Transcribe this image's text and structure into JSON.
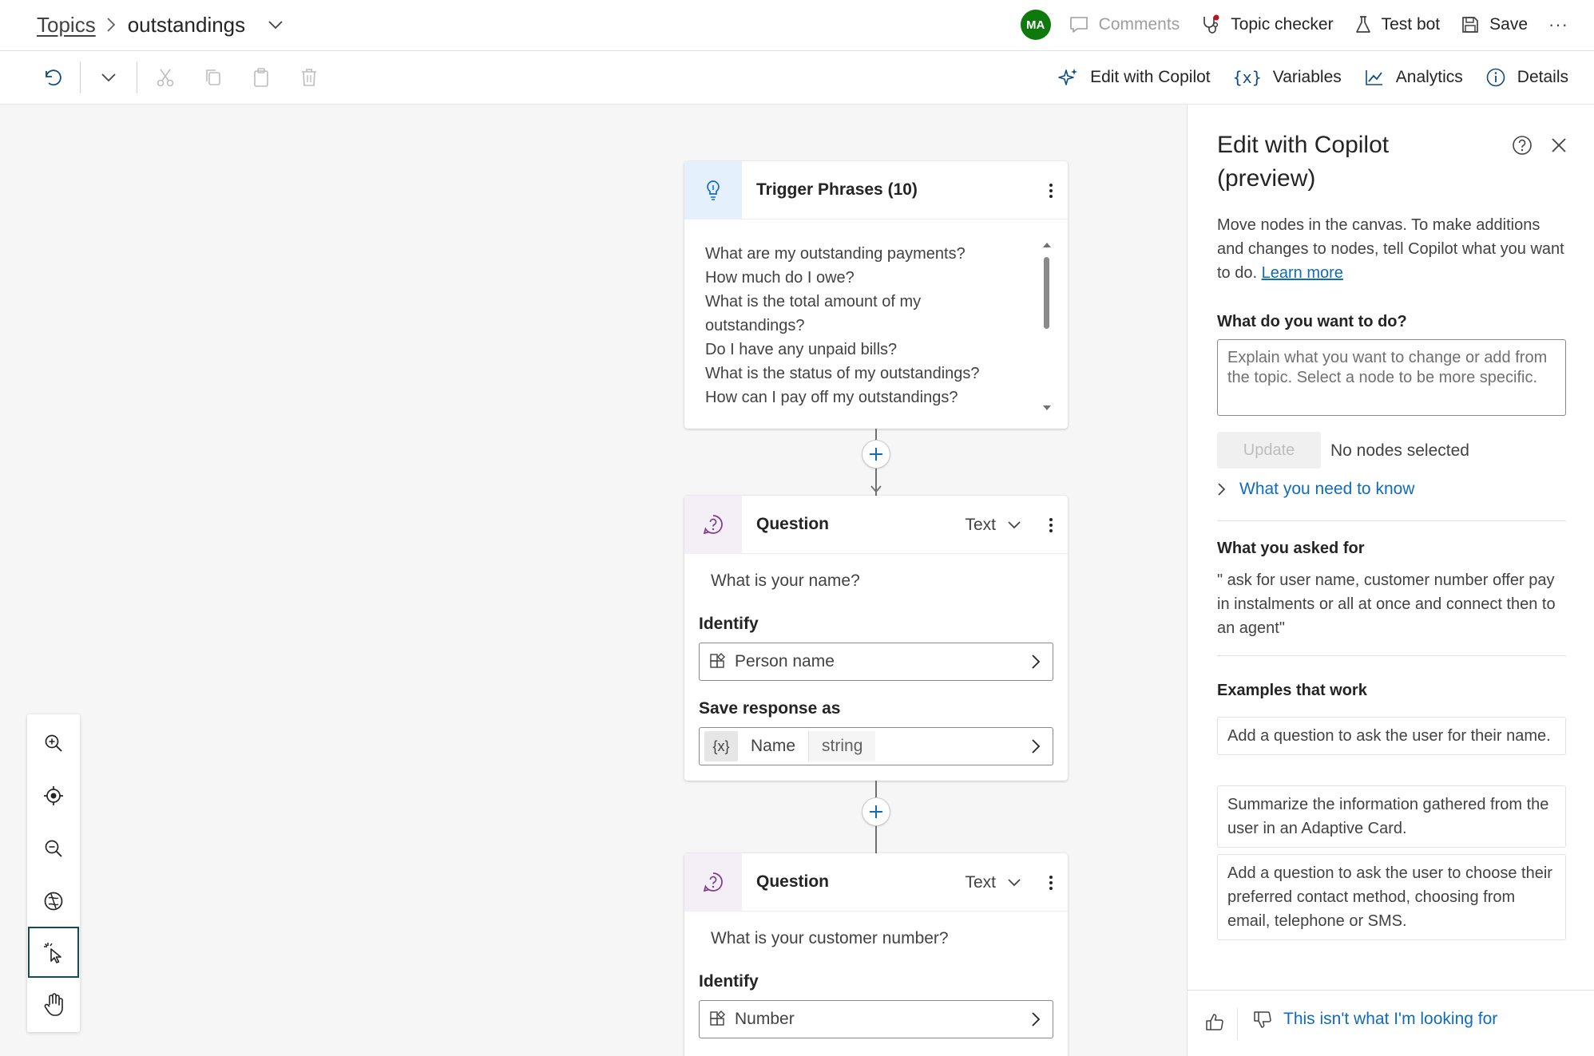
{
  "header": {
    "breadcrumb_root": "Topics",
    "breadcrumb_current": "outstandings",
    "avatar_initials": "MA",
    "comments_label": "Comments",
    "topic_checker_label": "Topic checker",
    "test_bot_label": "Test bot",
    "save_label": "Save",
    "more_label": "···"
  },
  "toolbar": {
    "edit_copilot_label": "Edit with Copilot",
    "variables_label": "Variables",
    "analytics_label": "Analytics",
    "details_label": "Details"
  },
  "canvas": {
    "trigger": {
      "title": "Trigger Phrases (10)",
      "phrases": [
        "What are my outstanding payments?",
        "How much do I owe?",
        "What is the total amount of my outstandings?",
        "Do I have any unpaid bills?",
        "What is the status of my outstandings?",
        "How can I pay off my outstandings?"
      ]
    },
    "question1": {
      "title": "Question",
      "type": "Text",
      "prompt": "What is your name?",
      "identify_label": "Identify",
      "identify_value": "Person name",
      "save_label": "Save response as",
      "var_icon": "{x}",
      "var_name": "Name",
      "var_type": "string"
    },
    "question2": {
      "title": "Question",
      "type": "Text",
      "prompt": "What is your customer number?",
      "identify_label": "Identify",
      "identify_value": "Number"
    }
  },
  "panel": {
    "title": "Edit with Copilot (preview)",
    "description": "Move nodes in the canvas. To make additions and changes to nodes, tell Copilot what you want to do.",
    "learn_more": "Learn more",
    "question_label": "What do you want to do?",
    "input_placeholder": "Explain what you want to change or add from the topic. Select a node to be more specific.",
    "update_label": "Update",
    "no_nodes": "No nodes selected",
    "what_to_know": "What you need to know",
    "asked_label": "What you asked for",
    "asked_text": "\" ask for user name, customer number offer pay in instalments or all at once and connect then to an agent\"",
    "examples_label": "Examples that work",
    "examples": [
      "Add a question to ask the user for their name.",
      "Summarize the information gathered from the user in an Adaptive Card.",
      "Add a question to ask the user to choose their preferred contact method, choosing from email, telephone or SMS."
    ],
    "feedback_negative": "This isn't what I'm looking for"
  },
  "colors": {
    "accent": "#0f6cbd",
    "avatar_bg": "#0e7a0d",
    "canvas_bg": "#f6f6f6",
    "trigger_icon": "#0f6cbd",
    "question_icon": "#7a3b8f"
  }
}
